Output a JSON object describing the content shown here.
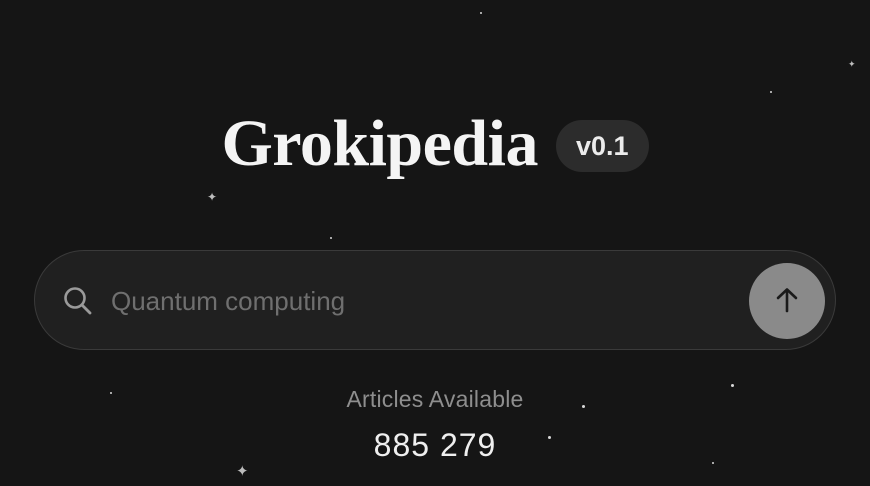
{
  "header": {
    "title": "Grokipedia",
    "version_badge": "v0.1"
  },
  "search": {
    "placeholder": "Quantum computing",
    "icon": "search-icon",
    "submit_icon": "arrow-up-icon"
  },
  "stats": {
    "label": "Articles Available",
    "count": "885 279"
  },
  "colors": {
    "background": "#151515",
    "search_field": "#202020",
    "submit_button": "#8a8a8a",
    "badge": "#2c2c2c"
  }
}
